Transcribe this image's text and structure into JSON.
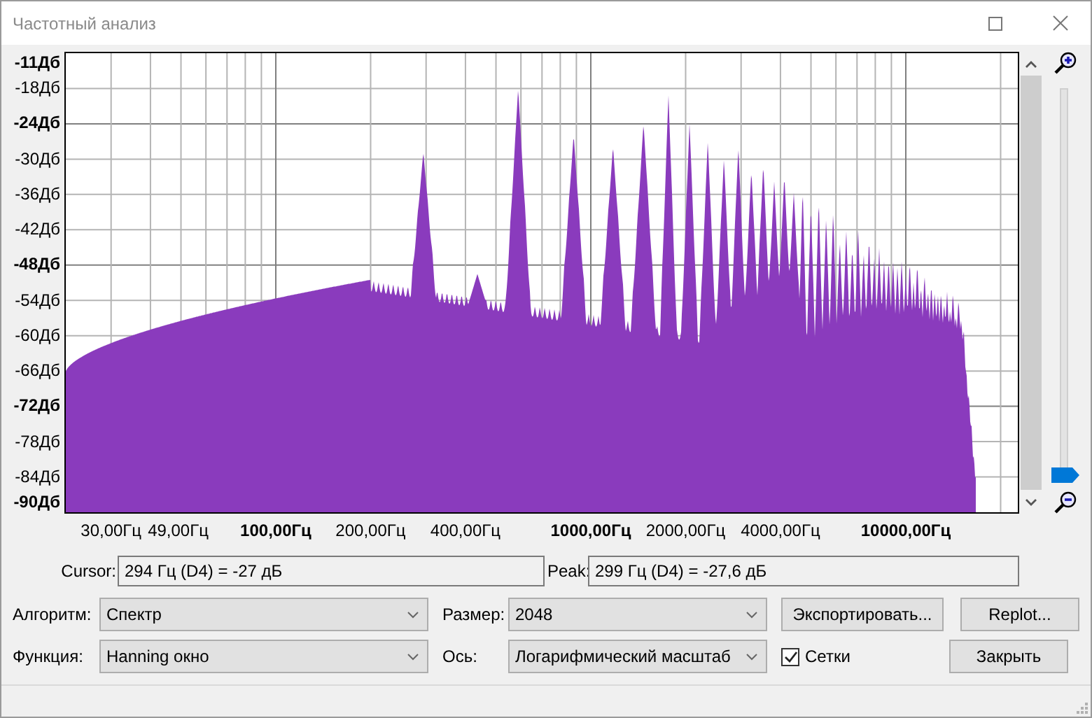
{
  "window": {
    "title": "Частотный анализ"
  },
  "plot": {
    "y_ticks": [
      {
        "label": "-11Дб",
        "major": true
      },
      {
        "label": "-18Дб",
        "major": false
      },
      {
        "label": "-24Дб",
        "major": true
      },
      {
        "label": "-30Дб",
        "major": false
      },
      {
        "label": "-36Дб",
        "major": false
      },
      {
        "label": "-42Дб",
        "major": false
      },
      {
        "label": "-48Дб",
        "major": true
      },
      {
        "label": "-54Дб",
        "major": false
      },
      {
        "label": "-60Дб",
        "major": false
      },
      {
        "label": "-66Дб",
        "major": false
      },
      {
        "label": "-72Дб",
        "major": true
      },
      {
        "label": "-78Дб",
        "major": false
      },
      {
        "label": "-84Дб",
        "major": false
      },
      {
        "label": "-90Дб",
        "major": true
      }
    ],
    "x_ticks": [
      {
        "label": "30,00Гц",
        "major": false
      },
      {
        "label": "49,00Гц",
        "major": false
      },
      {
        "label": "100,00Гц",
        "major": true
      },
      {
        "label": "200,00Гц",
        "major": false
      },
      {
        "label": "400,00Гц",
        "major": false
      },
      {
        "label": "1000,00Гц",
        "major": true
      },
      {
        "label": "2000,00Гц",
        "major": false
      },
      {
        "label": "4000,00Гц",
        "major": false
      },
      {
        "label": "10000,00Гц",
        "major": true
      }
    ],
    "grid": true
  },
  "zoom_slider": {
    "level": 0
  },
  "cursor": {
    "label": "Cursor:",
    "value": "294 Гц (D4) = -27 дБ"
  },
  "peak": {
    "label": "Peak:",
    "value": "299 Гц (D4) = -27,6 дБ"
  },
  "algorithm": {
    "label": "Алгоритм:",
    "value": "Спектр"
  },
  "size": {
    "label": "Размер:",
    "value": "2048"
  },
  "export_button": "Экспортировать...",
  "replot_button": "Replot...",
  "function": {
    "label": "Функция:",
    "value": "Hanning окно"
  },
  "axis": {
    "label": "Ось:",
    "value": "Логарифмический масштаб"
  },
  "grid_checkbox": {
    "label": "Сетки",
    "checked": true
  },
  "close_button": "Закрыть"
}
